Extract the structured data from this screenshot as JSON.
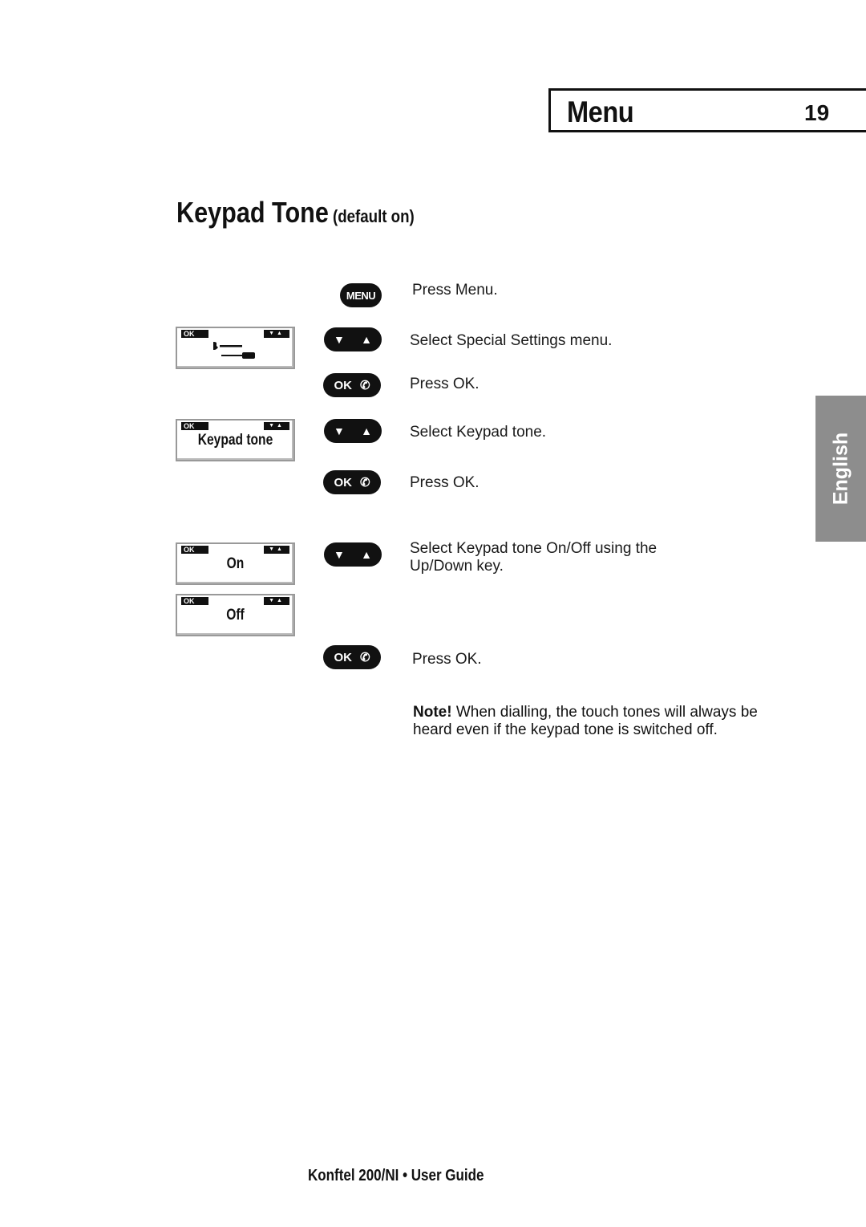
{
  "header": {
    "section": "Menu",
    "page_number": "19"
  },
  "heading": {
    "title": "Keypad Tone",
    "subtitle": "(default on)"
  },
  "language_tab": "English",
  "keys": {
    "menu": "MENU",
    "ok": "OK",
    "down": "▼",
    "up": "▲",
    "phone": "✆"
  },
  "displays": [
    {
      "ok": "OK",
      "arrows": "▼▲",
      "text": "",
      "icon": "tools-icon"
    },
    {
      "ok": "OK",
      "arrows": "▼▲",
      "text": "Keypad tone"
    },
    {
      "ok": "OK",
      "arrows": "▼▲",
      "text": "On"
    },
    {
      "ok": "OK",
      "arrows": "▼▲",
      "text": "Off"
    }
  ],
  "steps": [
    "Press Menu.",
    "Select Special Settings menu.",
    "Press OK.",
    "Select Keypad tone.",
    "Press OK.",
    "Select Keypad tone On/Off using the Up/Down key.",
    "Press OK."
  ],
  "note": {
    "label": "Note!",
    "text": " When dialling, the touch tones will always be heard even if the keypad tone is switched off."
  },
  "footer": "Konftel 200/NI • User Guide"
}
